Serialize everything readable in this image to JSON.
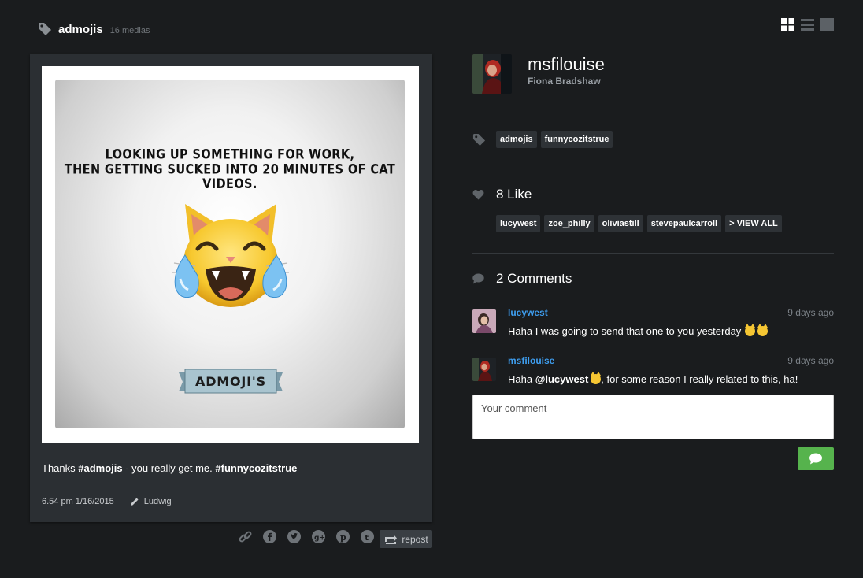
{
  "header": {
    "tag_title": "admojis",
    "media_count": "16 medias",
    "tag_icon": "tag-icon",
    "view_icons": [
      "grid-view-icon",
      "list-view-icon",
      "single-view-icon"
    ]
  },
  "post": {
    "image": {
      "line1": "LOOKING UP SOMETHING FOR WORK,",
      "line2": "THEN GETTING SUCKED INTO 20 MINUTES OF CAT VIDEOS.",
      "banner": "ADMOJI'S"
    },
    "caption": {
      "prefix": "Thanks ",
      "hashtag1": "#admojis",
      "middle": " - you really get me. ",
      "hashtag2": "#funnycozitstrue"
    },
    "timestamp": "6.54 pm 1/16/2015",
    "author": "Ludwig",
    "share_icons": [
      "link-icon",
      "facebook-icon",
      "twitter-icon",
      "google-plus-icon",
      "pinterest-icon",
      "tumblr-icon"
    ],
    "repost_label": "repost"
  },
  "profile": {
    "username": "msfilouise",
    "full_name": "Fiona Bradshaw"
  },
  "tags": [
    "admojis",
    "funnycozitstrue"
  ],
  "likes": {
    "heading": "8 Like",
    "users": [
      "lucywest",
      "zoe_philly",
      "oliviastill",
      "stevepaulcarroll"
    ],
    "view_all": "> VIEW ALL"
  },
  "comments": {
    "heading": "2 Comments",
    "items": [
      {
        "user": "lucywest",
        "time": "9 days ago",
        "text": "Haha I was going to send that one to you yesterday"
      },
      {
        "user": "msfilouise",
        "time": "9 days ago",
        "text_prefix": "Haha ",
        "mention": "@lucywest",
        "text_suffix": ", for some reason I really related to this, ha!"
      }
    ],
    "input_placeholder": "Your comment"
  },
  "colors": {
    "background": "#1a1c1e",
    "card": "#2b2f33",
    "link_blue": "#3e9ef0",
    "send_green": "#56b34d"
  }
}
